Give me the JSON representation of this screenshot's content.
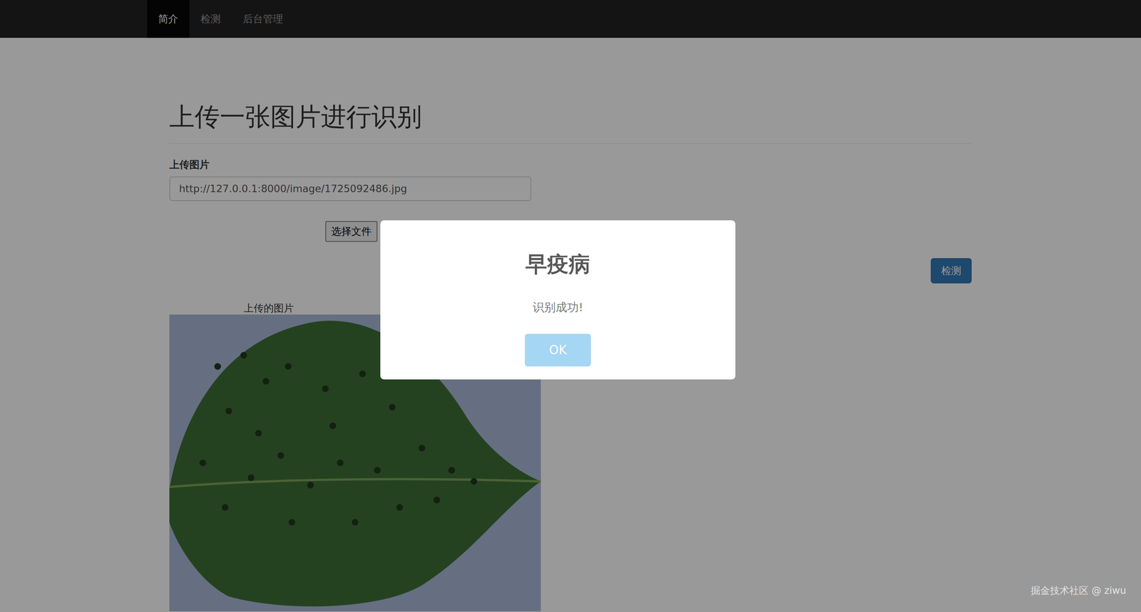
{
  "navbar": {
    "items": [
      {
        "label": "简介",
        "selected": true
      },
      {
        "label": "检测",
        "selected": false
      },
      {
        "label": "后台管理",
        "selected": false
      }
    ]
  },
  "page": {
    "heading": "上传一张图片进行识别",
    "upload_label": "上传图片",
    "url_field": {
      "value": "http://127.0.0.1:8000/image/1725092486.jpg"
    },
    "file_button": "选择文件",
    "detect_button": "检测",
    "image_caption": "上传的图片"
  },
  "modal": {
    "title": "早疫病",
    "message": "识别成功!",
    "buttons": [
      "OK"
    ]
  },
  "watermark": "掘金技术社区 @ ziwu"
}
